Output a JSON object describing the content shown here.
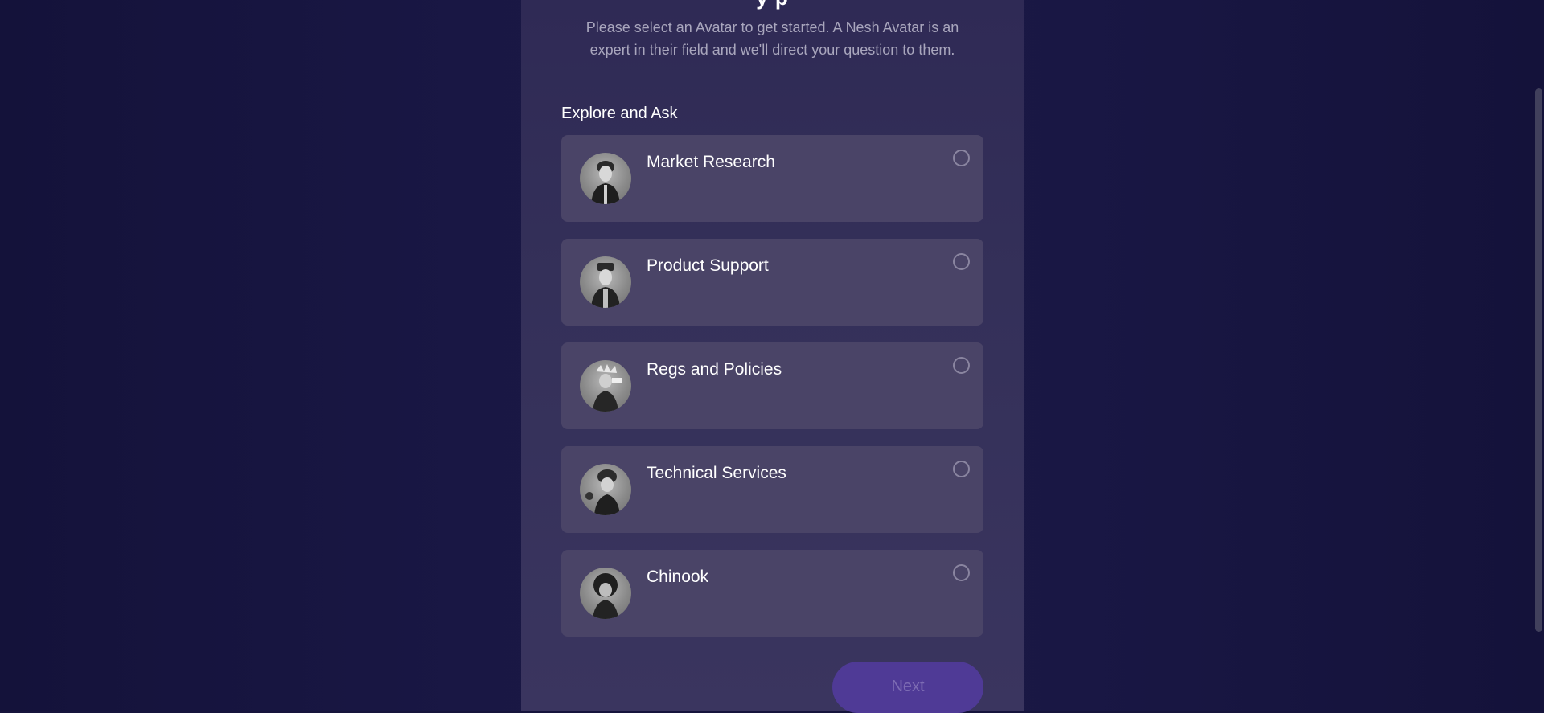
{
  "panel": {
    "title_fragment": "y  p",
    "intro_text": "Please select an Avatar to get started. A Nesh Avatar is an expert in their field and we'll direct your question to them."
  },
  "section": {
    "title": "Explore and Ask"
  },
  "avatars": [
    {
      "label": "Market Research",
      "icon": "person-avatar-icon",
      "selected": false
    },
    {
      "label": "Product Support",
      "icon": "person-avatar-icon",
      "selected": false
    },
    {
      "label": "Regs and Policies",
      "icon": "person-avatar-icon",
      "selected": false
    },
    {
      "label": "Technical Services",
      "icon": "person-avatar-icon",
      "selected": false
    },
    {
      "label": "Chinook",
      "icon": "person-avatar-icon",
      "selected": false
    }
  ],
  "footer": {
    "next_label": "Next"
  },
  "colors": {
    "background": "#16143c",
    "panel": "#343059",
    "card": "#4a4467",
    "button": "#4f3a96",
    "button_text": "#7d6cb3"
  }
}
